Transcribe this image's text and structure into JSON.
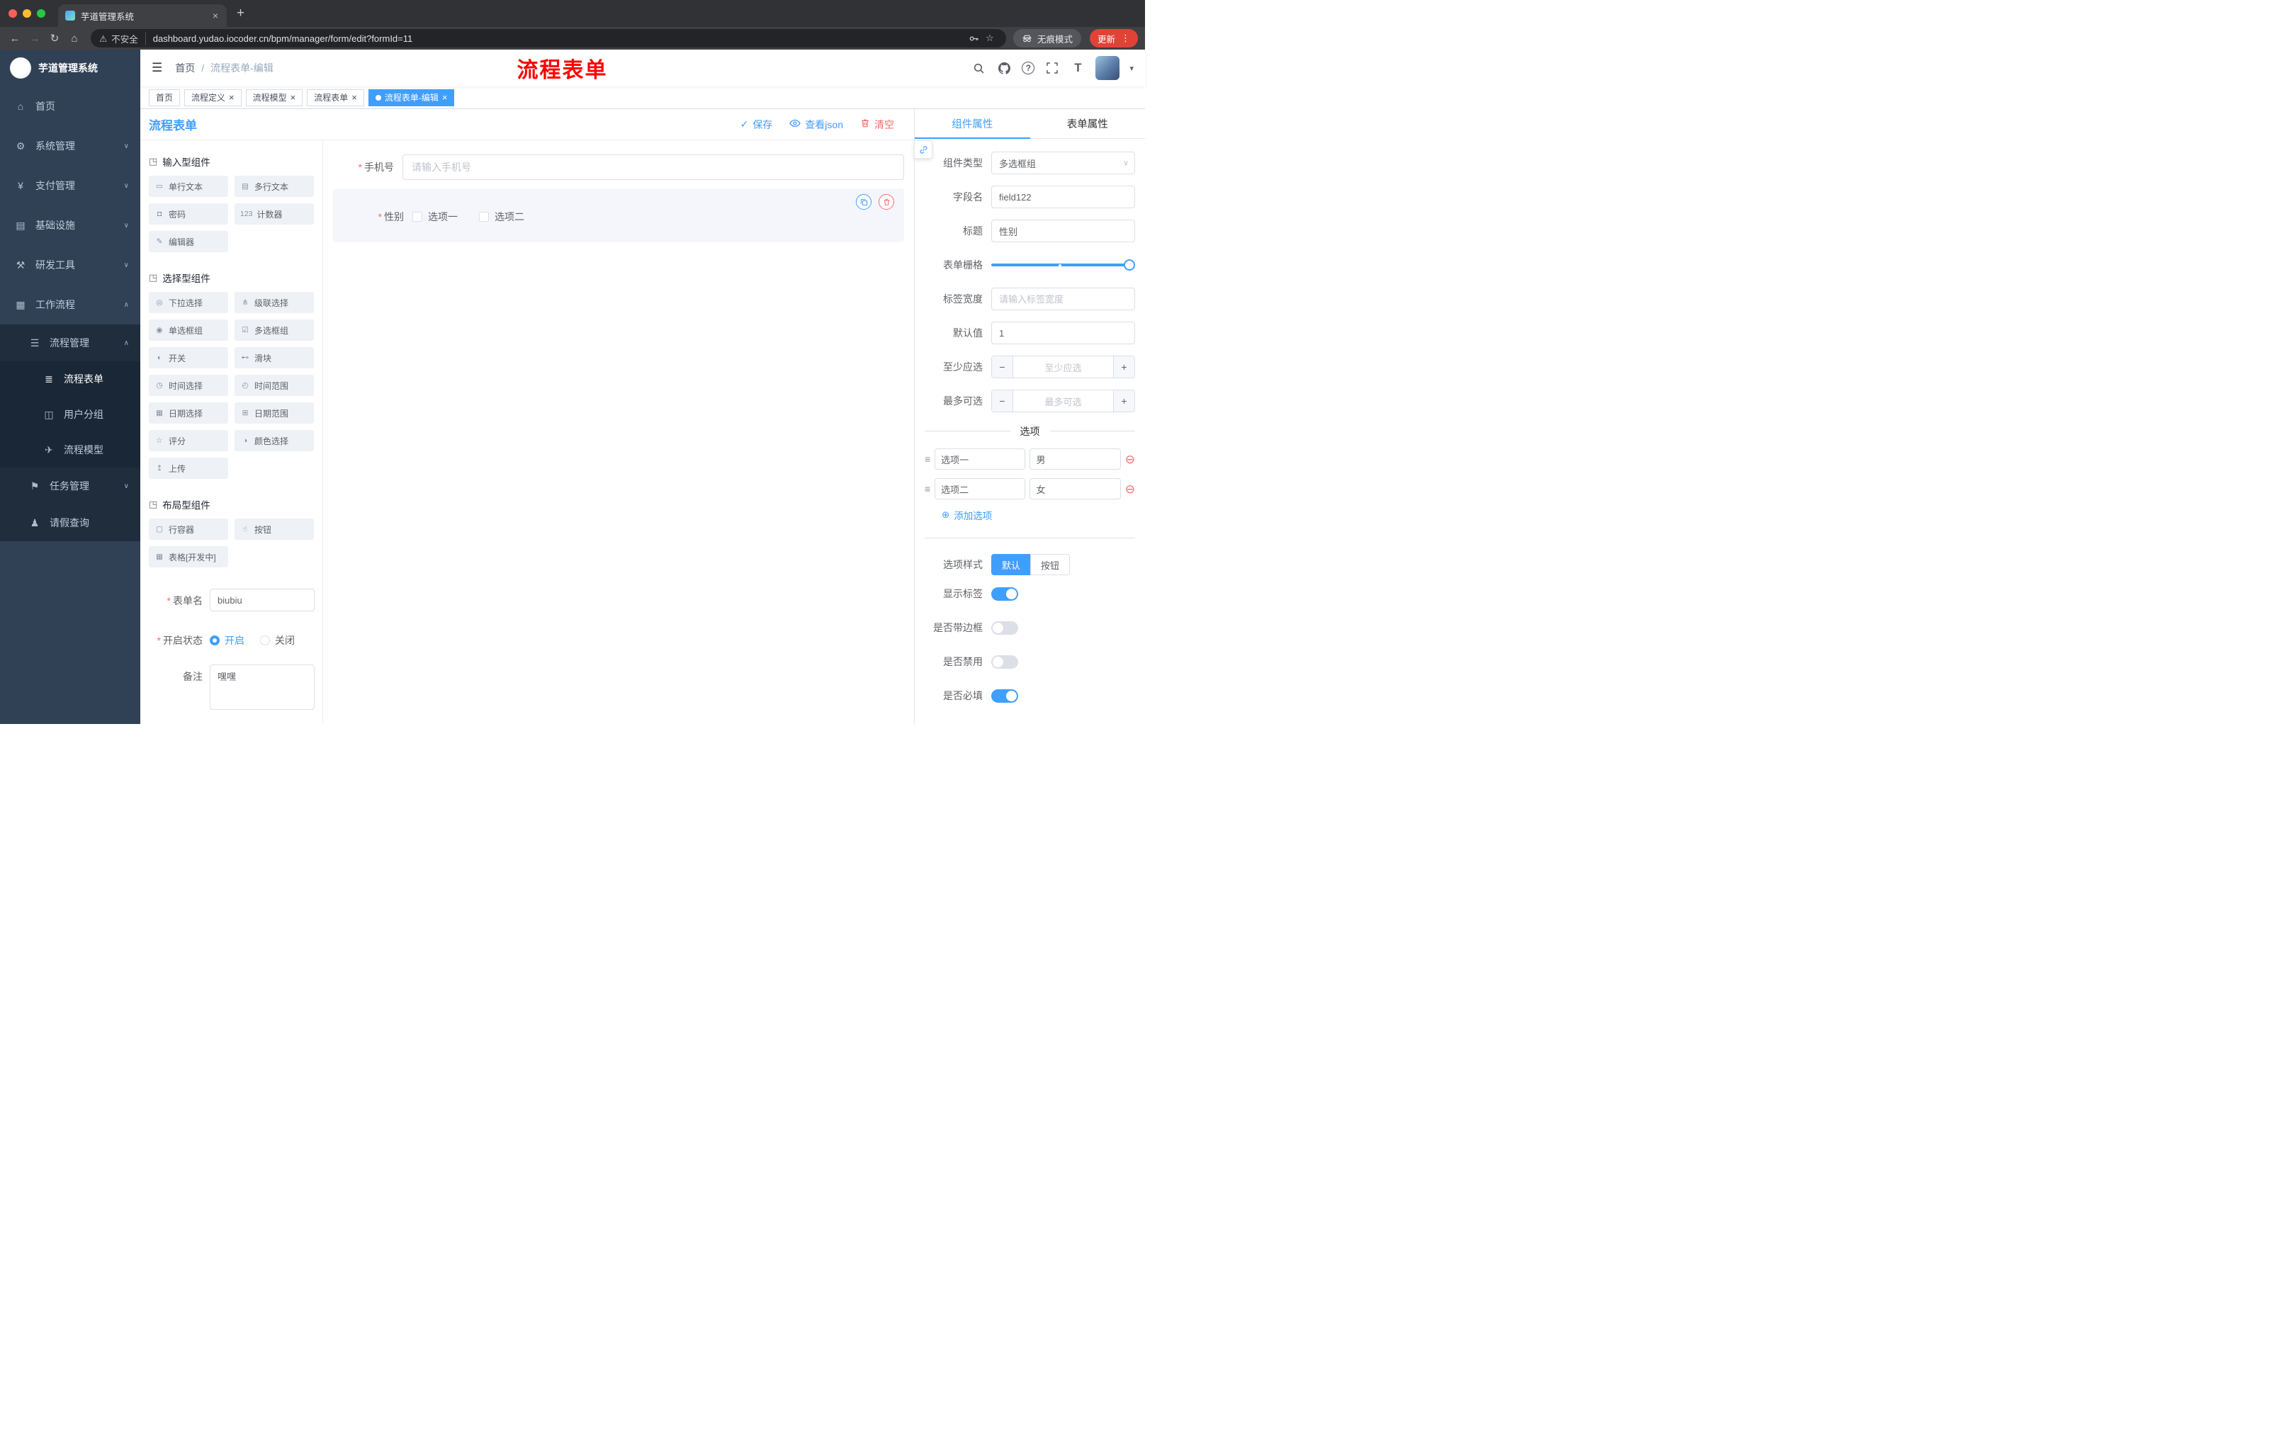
{
  "colors": {
    "primary": "#409eff",
    "danger": "#f56c6c",
    "annotation": "#ff0000",
    "sidebar": "#304156"
  },
  "icons": {
    "hamburger": "☰",
    "back": "←",
    "forward": "→",
    "reload": "↻",
    "home": "⌂",
    "warning": "⚠",
    "star": "☆",
    "close": "×",
    "new_tab": "+",
    "kebab": "⋮",
    "caret_down": "▾",
    "help": "?",
    "text_size": "T",
    "check": "✓",
    "chevron_down": "∨",
    "minus": "−",
    "plus": "+",
    "add": "⊕",
    "required": "*",
    "breadcrumb_sep": "/"
  },
  "browser": {
    "tab_title": "芋道管理系统",
    "security": "不安全",
    "url": "dashboard.yudao.iocoder.cn/bpm/manager/form/edit?formId=11",
    "incognito": "无痕模式",
    "update": "更新"
  },
  "sidebar": {
    "logo_title": "芋道管理系统",
    "menu": [
      {
        "label": "首页",
        "icon": "home-icon",
        "glyph": "⌂",
        "cls": "l1",
        "arrow": ""
      },
      {
        "label": "系统管理",
        "icon": "gear-icon",
        "glyph": "⚙",
        "cls": "l1",
        "arrow": "∨"
      },
      {
        "label": "支付管理",
        "icon": "payment-icon",
        "glyph": "¥",
        "cls": "l1",
        "arrow": "∨"
      },
      {
        "label": "基础设施",
        "icon": "infrastructure-icon",
        "glyph": "▤",
        "cls": "l1",
        "arrow": "∨"
      },
      {
        "label": "研发工具",
        "icon": "devtools-icon",
        "glyph": "⚒",
        "cls": "l1",
        "arrow": "∨"
      },
      {
        "label": "工作流程",
        "icon": "workflow-icon",
        "glyph": "▦",
        "cls": "l1 open",
        "arrow": "∧"
      },
      {
        "label": "流程管理",
        "icon": "process-management-icon",
        "glyph": "☰",
        "cls": "l2 open",
        "arrow": "∧"
      },
      {
        "label": "流程表单",
        "icon": "process-form-icon",
        "glyph": "≣",
        "cls": "l3 active",
        "arrow": ""
      },
      {
        "label": "用户分组",
        "icon": "user-group-icon",
        "glyph": "◫",
        "cls": "l3",
        "arrow": ""
      },
      {
        "label": "流程模型",
        "icon": "process-model-icon",
        "glyph": "✈",
        "cls": "l3",
        "arrow": ""
      },
      {
        "label": "任务管理",
        "icon": "task-management-icon",
        "glyph": "⚑",
        "cls": "l2",
        "arrow": "∨"
      },
      {
        "label": "请假查询",
        "icon": "leave-query-icon",
        "glyph": "♟",
        "cls": "l2",
        "arrow": ""
      }
    ]
  },
  "navbar": {
    "breadcrumb_home": "首页",
    "breadcrumb_current": "流程表单-编辑",
    "annotation": "流程表单"
  },
  "tags": [
    {
      "label": "首页",
      "cls": "",
      "closable": false,
      "active": false
    },
    {
      "label": "流程定义",
      "cls": "",
      "closable": true,
      "active": false
    },
    {
      "label": "流程模型",
      "cls": "",
      "closable": true,
      "active": false
    },
    {
      "label": "流程表单",
      "cls": "",
      "closable": true,
      "active": false
    },
    {
      "label": "流程表单-编辑",
      "cls": "active",
      "closable": true,
      "active": true
    }
  ],
  "designer": {
    "title": "流程表单",
    "actions": {
      "save": "保存",
      "view_json": "查看json",
      "clear": "清空"
    },
    "groups": [
      {
        "title": "输入型组件",
        "glyph": "◳",
        "items": [
          {
            "label": "单行文本",
            "icon": "single-line-text-icon",
            "glyph": "▭"
          },
          {
            "label": "多行文本",
            "icon": "textarea-icon",
            "glyph": "▤"
          },
          {
            "label": "密码",
            "icon": "password-icon",
            "glyph": "◘"
          },
          {
            "label": "计数器",
            "icon": "counter-icon",
            "glyph": "123"
          },
          {
            "label": "编辑器",
            "icon": "editor-icon",
            "glyph": "✎"
          }
        ]
      },
      {
        "title": "选择型组件",
        "glyph": "◳",
        "items": [
          {
            "label": "下拉选择",
            "icon": "select-icon",
            "glyph": "◎"
          },
          {
            "label": "级联选择",
            "icon": "cascader-icon",
            "glyph": "⋔"
          },
          {
            "label": "单选框组",
            "icon": "radio-group-icon",
            "glyph": "◉"
          },
          {
            "label": "多选框组",
            "icon": "checkbox-group-icon",
            "glyph": "☑"
          },
          {
            "label": "开关",
            "icon": "switch-icon",
            "glyph": "◐"
          },
          {
            "label": "滑块",
            "icon": "slider-icon",
            "glyph": "⊷"
          },
          {
            "label": "时间选择",
            "icon": "time-picker-icon",
            "glyph": "◷"
          },
          {
            "label": "时间范围",
            "icon": "time-range-icon",
            "glyph": "◴"
          },
          {
            "label": "日期选择",
            "icon": "date-picker-icon",
            "glyph": "▦"
          },
          {
            "label": "日期范围",
            "icon": "date-range-icon",
            "glyph": "⊞"
          },
          {
            "label": "评分",
            "icon": "rate-icon",
            "glyph": "☆"
          },
          {
            "label": "颜色选择",
            "icon": "color-picker-icon",
            "glyph": "◑"
          },
          {
            "label": "上传",
            "icon": "upload-icon",
            "glyph": "↥"
          }
        ]
      },
      {
        "title": "布局型组件",
        "glyph": "◳",
        "items": [
          {
            "label": "行容器",
            "icon": "row-container-icon",
            "glyph": "▢"
          },
          {
            "label": "按钮",
            "icon": "button-icon",
            "glyph": "☝"
          },
          {
            "label": "表格[开发中]",
            "icon": "table-icon",
            "glyph": "▦"
          }
        ]
      }
    ],
    "meta": {
      "form_name_label": "表单名",
      "form_name_value": "biubiu",
      "status_label": "开启状态",
      "status_on": "开启",
      "status_off": "关闭",
      "remark_label": "备注",
      "remark_value": "嘿嘿"
    },
    "canvas": {
      "phone": {
        "label": "手机号",
        "placeholder": "请输入手机号"
      },
      "gender": {
        "label": "性别",
        "options": [
          {
            "label": "选项一"
          },
          {
            "label": "选项二"
          }
        ]
      }
    }
  },
  "props": {
    "tab_component": "组件属性",
    "tab_form": "表单属性",
    "component_type_label": "组件类型",
    "component_type_value": "多选框组",
    "field_name_label": "字段名",
    "field_name_value": "field122",
    "title_label": "标题",
    "title_value": "性别",
    "grid_label": "表单栅格",
    "label_width_label": "标签宽度",
    "label_width_placeholder": "请输入标签宽度",
    "default_label": "默认值",
    "default_value": "1",
    "min_label": "至少应选",
    "min_placeholder": "至少应选",
    "max_label": "最多可选",
    "max_placeholder": "最多可选",
    "options_title": "选项",
    "options": [
      {
        "name": "选项一",
        "value": "男"
      },
      {
        "name": "选项二",
        "value": "女"
      }
    ],
    "add_option": "添加选项",
    "style_label": "选项样式",
    "style_default": "默认",
    "style_button": "按钮",
    "switches": [
      {
        "label": "显示标签",
        "cls": "on"
      },
      {
        "label": "是否带边框",
        "cls": ""
      },
      {
        "label": "是否禁用",
        "cls": ""
      },
      {
        "label": "是否必填",
        "cls": "on"
      }
    ]
  }
}
